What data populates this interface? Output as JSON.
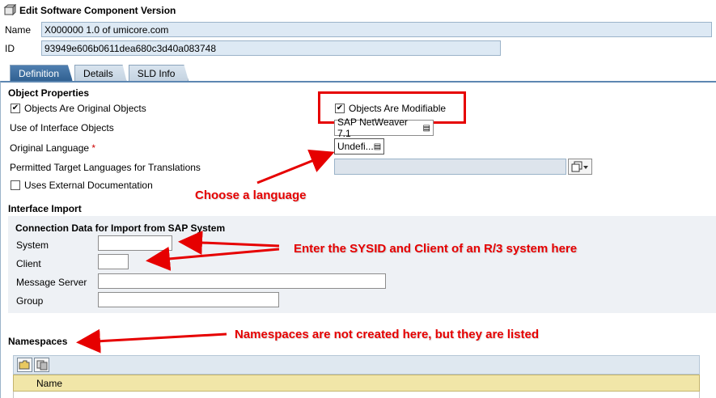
{
  "window": {
    "title": "Edit Software Component Version",
    "title_icon": "component-icon"
  },
  "header": {
    "name_label": "Name",
    "name_value": "X000000 1.0 of umicore.com",
    "id_label": "ID",
    "id_value": "93949e606b0611dea680c3d40a083748"
  },
  "tabs": [
    {
      "label": "Definition",
      "active": true
    },
    {
      "label": "Details",
      "active": false
    },
    {
      "label": "SLD Info",
      "active": false
    }
  ],
  "object_properties": {
    "title": "Object Properties",
    "original_objects": {
      "label": "Objects Are Original Objects",
      "checked": true
    },
    "modifiable": {
      "label": "Objects Are Modifiable",
      "checked": true
    },
    "interface_objects": {
      "label": "Use of Interface Objects",
      "value": "SAP NetWeaver 7.1"
    },
    "original_language": {
      "label": "Original Language",
      "required_marker": "*",
      "value": "Undefi..."
    },
    "target_languages": {
      "label": "Permitted Target Languages for Translations",
      "value": ""
    },
    "external_docs": {
      "label": "Uses External Documentation",
      "checked": false
    }
  },
  "interface_import": {
    "title": "Interface Import",
    "subtitle": "Connection Data for Import from SAP System",
    "system_label": "System",
    "system_value": "",
    "client_label": "Client",
    "client_value": "",
    "message_server_label": "Message Server",
    "message_server_value": "",
    "group_label": "Group",
    "group_value": ""
  },
  "namespaces": {
    "title": "Namespaces",
    "column_name": "Name",
    "toolbar_icons": [
      "open-folder-icon",
      "copy-icon"
    ]
  },
  "annotations": {
    "choose_language": "Choose a language",
    "sysid_client": "Enter the SYSID and Client of an R/3 system here",
    "namespaces_note": "Namespaces are not created here, but they are listed"
  },
  "colors": {
    "active_tab": "#3f6f9f",
    "field_bg": "#dde9f4",
    "annotation_red": "#e60000",
    "highlight_box": "#e60000",
    "table_header": "#f1e6a8"
  }
}
